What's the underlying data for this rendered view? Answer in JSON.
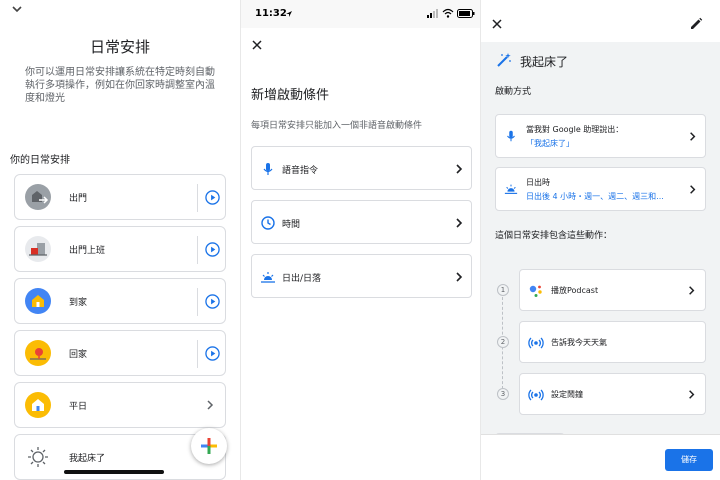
{
  "panel1": {
    "title": "日常安排",
    "description": "你可以運用日常安排讓系統在特定時刻自動執行多項操作，例如在你回家時調整室內溫度和燈光",
    "section_title": "你的日常安排",
    "routines": [
      {
        "label": "出門",
        "icon": "leaving-home-icon",
        "action": "play"
      },
      {
        "label": "出門上班",
        "icon": "commute-to-work-icon",
        "action": "play"
      },
      {
        "label": "到家",
        "icon": "arrive-home-icon",
        "action": "play"
      },
      {
        "label": "回家",
        "icon": "commute-home-icon",
        "action": "play"
      },
      {
        "label": "平日",
        "icon": "weekday-icon",
        "action": "chevron"
      },
      {
        "label": "我起床了",
        "icon": "sun-icon",
        "action": "none"
      }
    ]
  },
  "panel2": {
    "status_time": "11:32",
    "title": "新增啟動條件",
    "subtitle": "每項日常安排只能加入一個非語音啟動條件",
    "options": [
      {
        "label": "語音指令",
        "icon": "microphone-icon"
      },
      {
        "label": "時間",
        "icon": "clock-icon"
      },
      {
        "label": "日出/日落",
        "icon": "sunrise-icon"
      }
    ]
  },
  "panel3": {
    "title": "我起床了",
    "start_heading": "啟動方式",
    "triggers": [
      {
        "line1": "當我對 Google 助理說出：",
        "line2": "「我起床了」",
        "icon": "microphone-icon"
      },
      {
        "line1": "日出時",
        "line2": "日出後 4 小時・週一、週二、週三和...",
        "icon": "sunrise-icon"
      }
    ],
    "actions_heading": "這個日常安排包含這些動作：",
    "actions": [
      {
        "num": "1",
        "label": "播放Podcast",
        "icon": "assistant-icon",
        "has_arrow": true
      },
      {
        "num": "2",
        "label": "告訴我今天天氣",
        "icon": "broadcast-icon",
        "has_arrow": false
      },
      {
        "num": "3",
        "label": "設定鬧鐘",
        "icon": "broadcast-icon",
        "has_arrow": true
      }
    ],
    "save_label": "儲存"
  },
  "colors": {
    "accent": "#1a73e8",
    "divider": "#dadce0",
    "panel_bg": "#f1f3f4"
  }
}
